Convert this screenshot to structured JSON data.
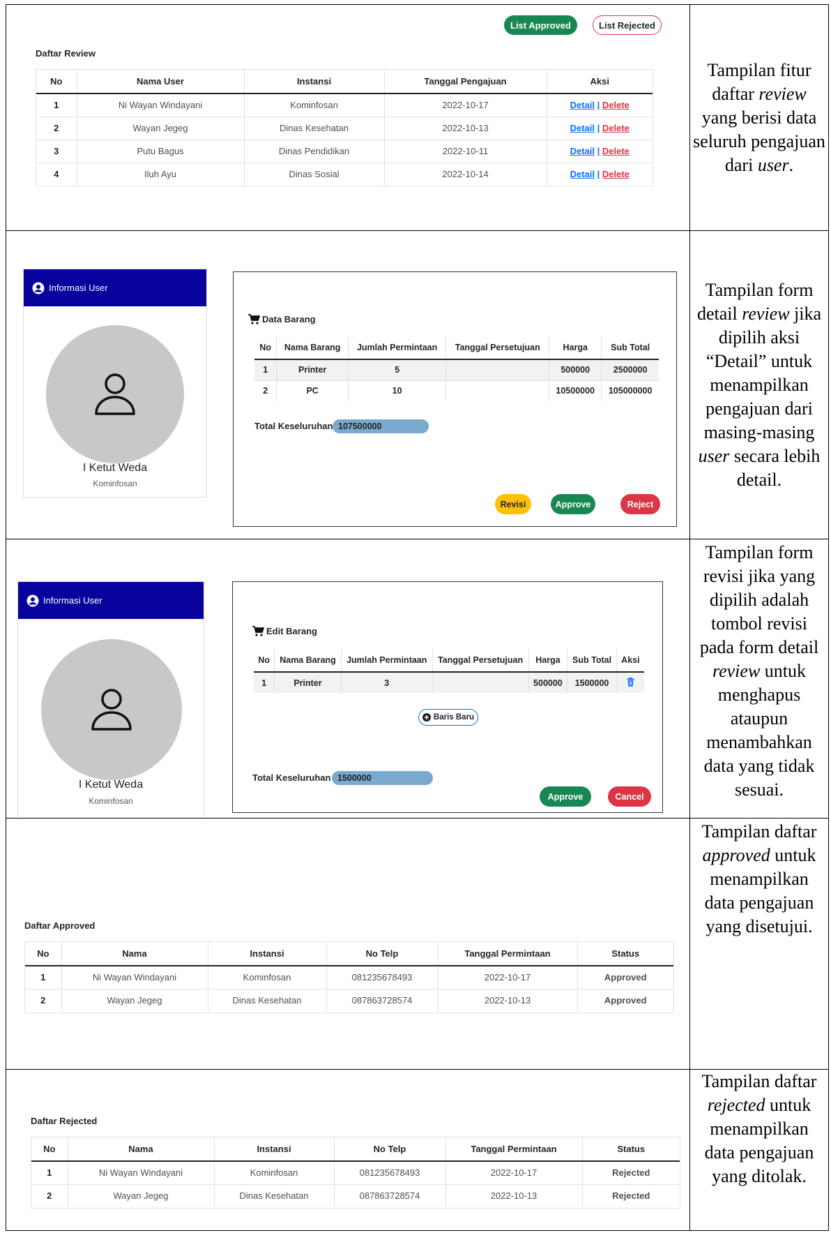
{
  "review": {
    "btn_approved": "List Approved",
    "btn_rejected": "List Rejected",
    "title": "Daftar Review",
    "headers": [
      "No",
      "Nama User",
      "Instansi",
      "Tanggal Pengajuan",
      "Aksi"
    ],
    "rows": [
      {
        "no": "1",
        "nama": "Ni Wayan Windayani",
        "instansi": "Kominfosan",
        "tanggal": "2022-10-17"
      },
      {
        "no": "2",
        "nama": "Wayan Jegeg",
        "instansi": "Dinas Kesehatan",
        "tanggal": "2022-10-13"
      },
      {
        "no": "3",
        "nama": "Putu Bagus",
        "instansi": "Dinas Pendidikan",
        "tanggal": "2022-10-11"
      },
      {
        "no": "4",
        "nama": "Iluh Ayu",
        "instansi": "Dinas Sosial",
        "tanggal": "2022-10-14"
      }
    ],
    "detail_label": "Detail",
    "sep": "|",
    "delete_label": "Delete"
  },
  "detail": {
    "user_header": "Informasi User",
    "user_name": "I Ketut Weda",
    "user_instansi": "Kominfosan",
    "title": "Data Barang",
    "headers": [
      "No",
      "Nama Barang",
      "Jumlah Permintaan",
      "Tanggal Persetujuan",
      "Harga",
      "Sub Total"
    ],
    "rows": [
      {
        "no": "1",
        "nama": "Printer",
        "jumlah": "5",
        "tanggal": "",
        "harga": "500000",
        "sub": "2500000"
      },
      {
        "no": "2",
        "nama": "PC",
        "jumlah": "10",
        "tanggal": "",
        "harga": "10500000",
        "sub": "105000000"
      }
    ],
    "total_label": "Total Keseluruhan",
    "total_value": "107500000",
    "btn_revisi": "Revisi",
    "btn_approve": "Approve",
    "btn_reject": "Reject"
  },
  "edit": {
    "user_header": "Informasi User",
    "user_name": "I Ketut Weda",
    "user_instansi": "Kominfosan",
    "title": "Edit Barang",
    "headers": [
      "No",
      "Nama Barang",
      "Jumlah Permintaan",
      "Tanggal Persetujuan",
      "Harga",
      "Sub Total",
      "Aksi"
    ],
    "rows": [
      {
        "no": "1",
        "nama": "Printer",
        "jumlah": "3",
        "tanggal": "",
        "harga": "500000",
        "sub": "1500000"
      }
    ],
    "btn_new_row": "Baris Baru",
    "total_label": "Total Keseluruhan",
    "total_value": "1500000",
    "btn_approve": "Approve",
    "btn_cancel": "Cancel"
  },
  "approved": {
    "title": "Daftar Approved",
    "headers": [
      "No",
      "Nama",
      "Instansi",
      "No Telp",
      "Tanggal Permintaan",
      "Status"
    ],
    "rows": [
      {
        "no": "1",
        "nama": "Ni Wayan Windayani",
        "instansi": "Kominfosan",
        "telp": "081235678493",
        "tanggal": "2022-10-17",
        "status": "Approved"
      },
      {
        "no": "2",
        "nama": "Wayan Jegeg",
        "instansi": "Dinas Kesehatan",
        "telp": "087863728574",
        "tanggal": "2022-10-13",
        "status": "Approved"
      }
    ]
  },
  "rejected": {
    "title": "Daftar Rejected",
    "headers": [
      "No",
      "Nama",
      "Instansi",
      "No Telp",
      "Tanggal Permintaan",
      "Status"
    ],
    "rows": [
      {
        "no": "1",
        "nama": "Ni Wayan Windayani",
        "instansi": "Kominfosan",
        "telp": "081235678493",
        "tanggal": "2022-10-17",
        "status": "Rejected"
      },
      {
        "no": "2",
        "nama": "Wayan Jegeg",
        "instansi": "Dinas Kesehatan",
        "telp": "087863728574",
        "tanggal": "2022-10-13",
        "status": "Rejected"
      }
    ]
  },
  "descriptions": {
    "d1": [
      "Tampilan fitur daftar ",
      "review",
      " yang berisi data seluruh pengajuan dari ",
      "user",
      "."
    ],
    "d2": [
      "Tampilan form detail ",
      "review",
      " jika dipilih aksi “Detail” untuk menampilkan pengajuan dari masing-masing ",
      "user",
      " secara lebih detail."
    ],
    "d3": [
      "Tampilan form revisi jika yang dipilih adalah tombol revisi pada form detail ",
      "review",
      " untuk menghapus ataupun menambahkan data yang tidak sesuai."
    ],
    "d4": [
      "Tampilan daftar ",
      "approved",
      " untuk menampilkan data pengajuan yang disetujui."
    ],
    "d5": [
      "Tampilan daftar ",
      "rejected",
      " untuk menampilkan data pengajuan yang ditolak."
    ]
  },
  "colors": {
    "green": "#198754",
    "red": "#dc3545",
    "blue_link": "#0d6efd",
    "user_header": "#06029b",
    "warning": "#ffc107",
    "total_bar": "#79a9cd"
  }
}
